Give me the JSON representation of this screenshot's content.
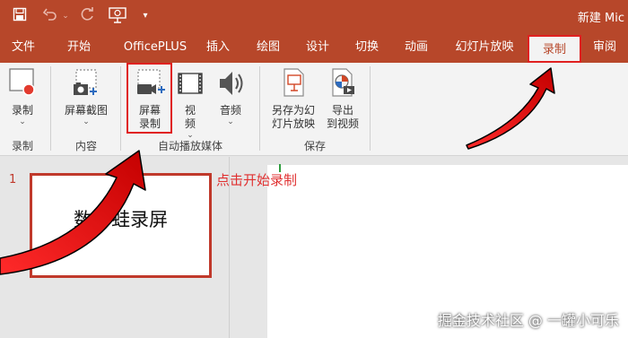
{
  "titlebar": {
    "title": "新建 Mic",
    "quick_access_icons": [
      "save-icon",
      "undo-icon",
      "undo-dropdown-icon",
      "redo-icon",
      "present-icon",
      "customize-icon"
    ]
  },
  "tabs": [
    {
      "label": "文件"
    },
    {
      "label": "开始"
    },
    {
      "label": "OfficePLUS"
    },
    {
      "label": "插入"
    },
    {
      "label": "绘图"
    },
    {
      "label": "设计"
    },
    {
      "label": "切换"
    },
    {
      "label": "动画"
    },
    {
      "label": "幻灯片放映"
    },
    {
      "label": "录制",
      "active": true
    },
    {
      "label": "审阅"
    }
  ],
  "ribbon": {
    "buttons": {
      "record": "录制",
      "screenshot": "屏幕截图",
      "screen_record": "屏幕\n录制",
      "video": "视\n频",
      "audio": "音频",
      "save_as_show": "另存为幻\n灯片放映",
      "export_video": "导出\n到视频"
    },
    "groups": {
      "record": "录制",
      "content": "内容",
      "auto_media": "自动播放媒体",
      "save": "保存"
    },
    "colors": {
      "accent": "#b7472a",
      "highlight": "#e02020"
    }
  },
  "workspace": {
    "slide_number": "1",
    "slide_thumbnail_text": "数　蛙录屏",
    "annotation": "点击开始录制",
    "watermark": "掘金技术社区 @ 一罐小可乐"
  }
}
